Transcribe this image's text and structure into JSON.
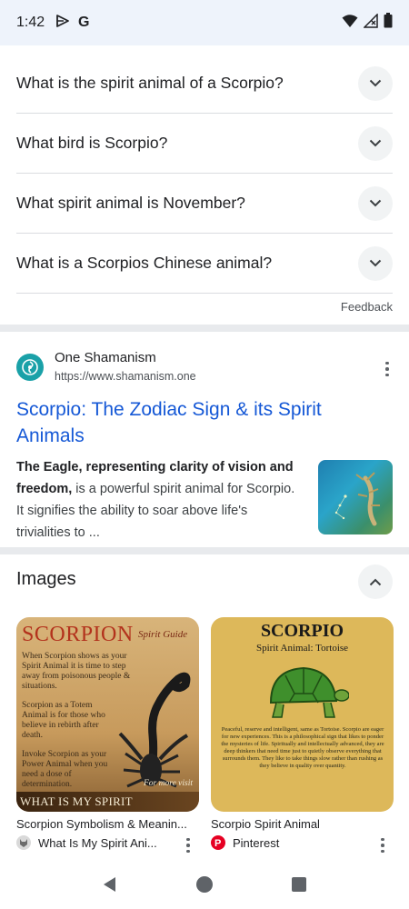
{
  "status_bar": {
    "time": "1:42",
    "left_icons": [
      "play-protect-icon",
      "google-g-icon"
    ],
    "right_icons": [
      "wifi-icon",
      "cell-signal-icon",
      "battery-icon"
    ]
  },
  "people_also_ask": {
    "questions": [
      "What is the spirit animal of a Scorpio?",
      "What bird is Scorpio?",
      "What spirit animal is November?",
      "What is a Scorpios Chinese animal?"
    ],
    "feedback_label": "Feedback"
  },
  "result": {
    "site_name": "One Shamanism",
    "url": "https://www.shamanism.one",
    "title": "Scorpio: The Zodiac Sign & its Spirit Animals",
    "snippet_bold": "The Eagle, representing clarity of vision and freedom,",
    "snippet_rest": " is a powerful spirit animal for Scorpio. It signifies the ability to soar above life's trivialities to ..."
  },
  "images": {
    "header": "Images",
    "cards": [
      {
        "caption": "Scorpion Symbolism & Meanin...",
        "source": "What Is My Spirit Ani...",
        "art": {
          "title": "SCORPION",
          "subtitle": "Spirit Guide",
          "line1": "When Scorpion shows as your Spirit Animal it is time to step away from poisonous people & situations.",
          "line2": "Scorpion as a Totem Animal is for those who believe in rebirth after death.",
          "line3": "Invoke Scorpion as your Power Animal when you need a dose of determination.",
          "more": "For more visit",
          "footer": "WHAT IS MY SPIRIT ANIMAL.COM"
        }
      },
      {
        "caption": "Scorpio Spirit Animal",
        "source": "Pinterest",
        "art": {
          "title": "SCORPIO",
          "subtitle": "Spirit Animal: Tortoise",
          "body": "Peaceful, reserve and intelligent, same as Tortoise. Scorpio are eager for new experiences. This is a philosophical sign that likes to ponder the mysteries of life. Spiritually and intellectually advanced, they are deep thinkers that need time just to quietly observe everything that surrounds them. They like to take things slow rather than rushing as they believe in quality over quantity."
        }
      }
    ]
  },
  "nav_bar": {
    "buttons": [
      "back-icon",
      "home-icon",
      "recents-icon"
    ]
  },
  "colors": {
    "link": "#1558d6",
    "status_bar_bg": "#eef3fb",
    "divider": "#e8eaed",
    "pinterest": "#e60023"
  }
}
